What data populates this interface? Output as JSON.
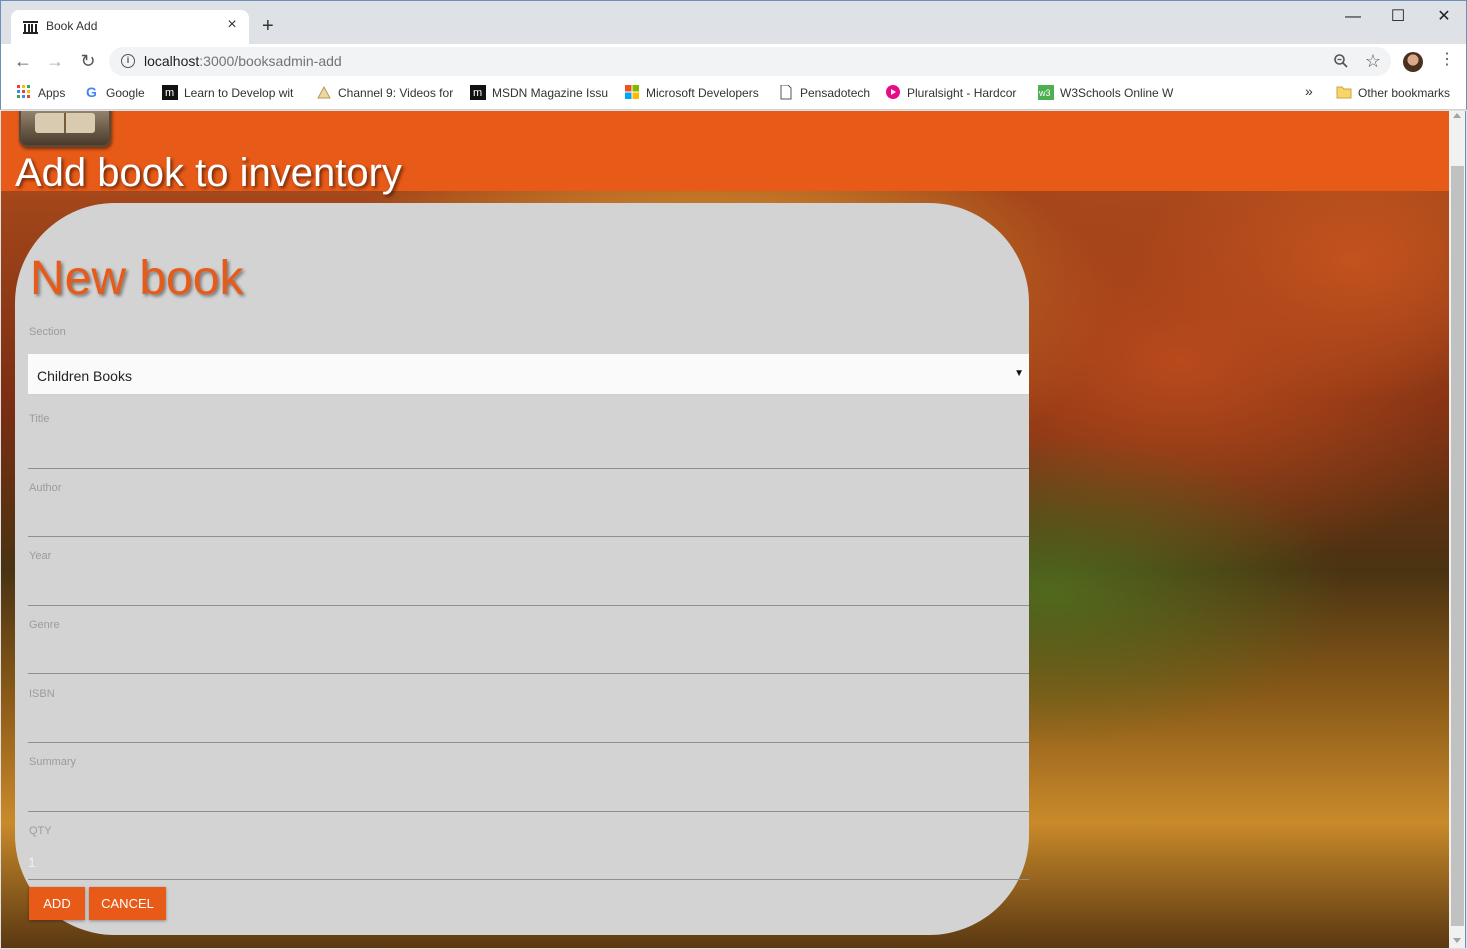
{
  "browser": {
    "tab_title": "Book Add",
    "tab_close": "×",
    "new_tab": "+",
    "window_controls": {
      "minimize": "—",
      "maximize": "☐",
      "close": "✕"
    },
    "url_host": "localhost",
    "url_path": ":3000/booksadmin-add",
    "overflow_chevron": "»",
    "bookmarks": [
      {
        "label": "Apps",
        "icon": "apps-grid-icon"
      },
      {
        "label": "Google",
        "icon": "google-icon"
      },
      {
        "label": "Learn to Develop wit",
        "icon": "m-logo-icon"
      },
      {
        "label": "Channel 9: Videos for",
        "icon": "channel9-icon"
      },
      {
        "label": "MSDN Magazine Issu",
        "icon": "m-logo-icon"
      },
      {
        "label": "Microsoft Developers",
        "icon": "microsoft-icon"
      },
      {
        "label": "Pensadotech",
        "icon": "page-icon"
      },
      {
        "label": "Pluralsight - Hardcor",
        "icon": "pluralsight-icon"
      },
      {
        "label": "W3Schools Online W",
        "icon": "w3schools-icon"
      }
    ],
    "other_bookmarks": "Other bookmarks"
  },
  "header": {
    "title": "Add book to inventory"
  },
  "form": {
    "heading": "New book",
    "section_label": "Section",
    "section_value": "Children Books",
    "fields": [
      {
        "label": "Title",
        "value": ""
      },
      {
        "label": "Author",
        "value": ""
      },
      {
        "label": "Year",
        "value": ""
      },
      {
        "label": "Genre",
        "value": ""
      },
      {
        "label": "ISBN",
        "value": ""
      },
      {
        "label": "Summary",
        "value": ""
      },
      {
        "label": "QTY",
        "value": "1"
      }
    ],
    "add_label": "ADD",
    "cancel_label": "CANCEL"
  },
  "colors": {
    "accent": "#e85a17",
    "card": "#d3d3d3"
  }
}
